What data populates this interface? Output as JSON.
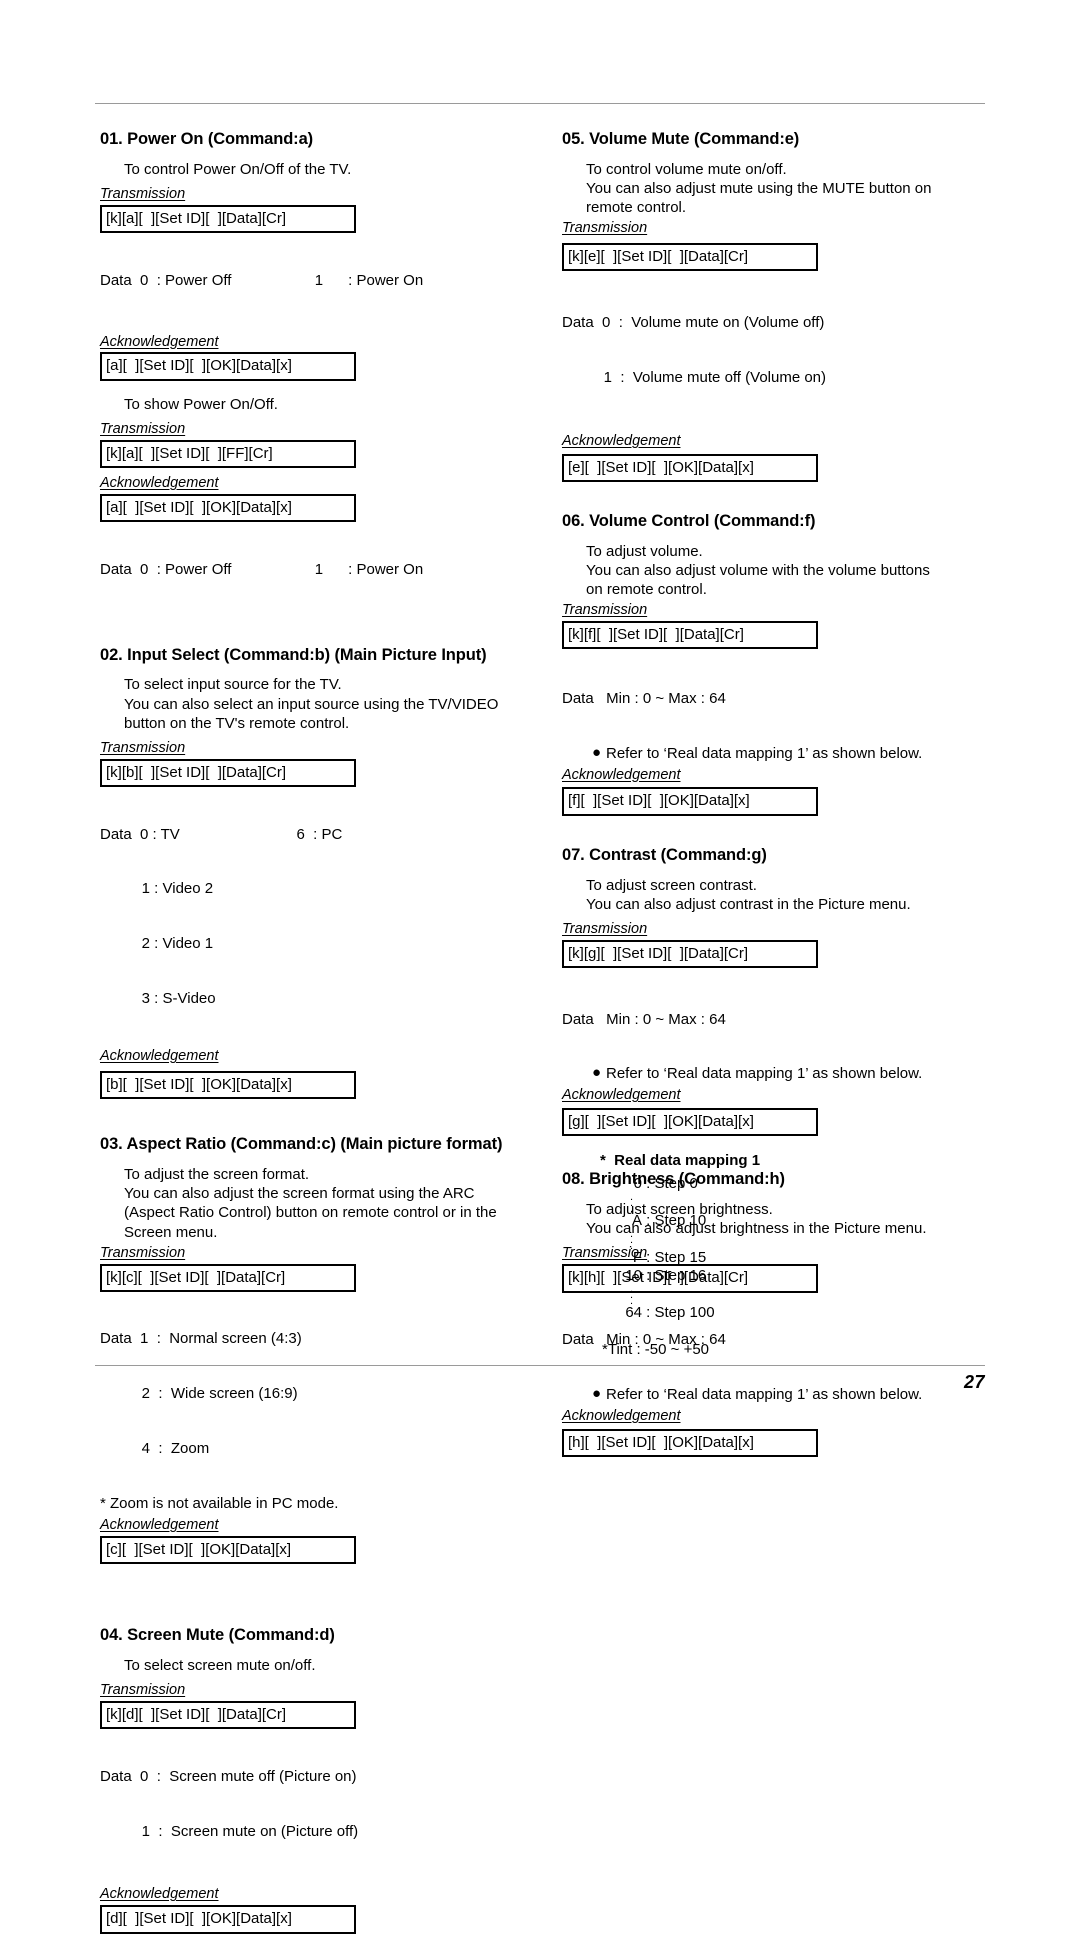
{
  "page": {
    "number": "27"
  },
  "sections": [
    {
      "id": "01",
      "title": "01. Power On (Command:a)",
      "desc": [
        "To control Power On/Off of the TV."
      ],
      "transmission_label": "Transmission",
      "transmission_box": "[k][a][  ][Set ID][  ][Data][Cr]",
      "data_lines": [
        "Data  0  : Power Off                    1      : Power On"
      ],
      "ack_label": "Acknowledgement",
      "ack_box": "[a][  ][Set ID][  ][OK][Data][x]",
      "desc2": [
        "To show Power On/Off."
      ],
      "transmission_label2": "Transmission",
      "transmission_box2": "[k][a][  ][Set ID][  ][FF][Cr]",
      "ack_label2": "Acknowledgement",
      "ack_box2": "[a][  ][Set ID][  ][OK][Data][x]",
      "data_lines2": [
        "Data  0  : Power Off                    1      : Power On"
      ]
    },
    {
      "id": "02",
      "title": "02. Input Select (Command:b) (Main Picture Input)",
      "desc": [
        "To select input source for the TV.",
        "You can also select an input source using the TV/VIDEO",
        "button on the TV's remote control."
      ],
      "transmission_label": "Transmission",
      "transmission_box": "[k][b][  ][Set ID][  ][Data][Cr]",
      "data_lines": [
        "Data  0 : TV                            6  : PC",
        "          1 : Video 2",
        "          2 : Video 1",
        "          3 : S-Video"
      ],
      "ack_label": "Acknowledgement",
      "ack_box": "[b][  ][Set ID][  ][OK][Data][x]"
    },
    {
      "id": "03",
      "title": "03. Aspect Ratio (Command:c) (Main picture format)",
      "desc": [
        "To adjust the screen format.",
        "You can also adjust the screen format using the ARC",
        "(Aspect Ratio Control) button on remote control or in the",
        "Screen menu."
      ],
      "transmission_label": "Transmission",
      "transmission_box": "[k][c][  ][Set ID][  ][Data][Cr]",
      "data_lines": [
        "Data  1  :  Normal screen (4:3)",
        "          2  :  Wide screen (16:9)",
        "          4  :  Zoom"
      ],
      "note": "* Zoom is not available in PC mode.",
      "ack_label": "Acknowledgement",
      "ack_box": "[c][  ][Set ID][  ][OK][Data][x]"
    },
    {
      "id": "04",
      "title": "04. Screen Mute (Command:d)",
      "desc": [
        "To select screen mute on/off."
      ],
      "transmission_label": "Transmission",
      "transmission_box": "[k][d][  ][Set ID][  ][Data][Cr]",
      "data_lines": [
        "Data  0  :  Screen mute off (Picture on)",
        "          1  :  Screen mute on (Picture off)"
      ],
      "ack_label": "Acknowledgement",
      "ack_box": "[d][  ][Set ID][  ][OK][Data][x]"
    },
    {
      "id": "05",
      "title": "05. Volume Mute (Command:e)",
      "desc": [
        "To control volume mute on/off.",
        "You can also adjust mute using the MUTE button on",
        "remote control."
      ],
      "transmission_label": "Transmission",
      "transmission_box": "[k][e][  ][Set ID][  ][Data][Cr]",
      "data_lines": [
        "Data  0  :  Volume mute on (Volume off)",
        "          1  :  Volume mute off (Volume on)"
      ],
      "ack_label": "Acknowledgement",
      "ack_box": "[e][  ][Set ID][  ][OK][Data][x]"
    },
    {
      "id": "06",
      "title": "06. Volume Control (Command:f)",
      "desc": [
        "To adjust volume.",
        "You can also adjust volume with the volume buttons",
        "on remote control."
      ],
      "transmission_label": "Transmission",
      "transmission_box": "[k][f][  ][Set ID][  ][Data][Cr]",
      "data_lines": [
        "Data   Min : 0 ~ Max : 64"
      ],
      "bullet": "Refer to ‘Real data mapping 1’ as shown below.",
      "ack_label": "Acknowledgement",
      "ack_box": "[f][  ][Set ID][  ][OK][Data][x]"
    },
    {
      "id": "07",
      "title": "07. Contrast (Command:g)",
      "desc": [
        "To adjust screen contrast.",
        "You can also adjust contrast in the Picture menu."
      ],
      "transmission_label": "Transmission",
      "transmission_box": "[k][g][  ][Set ID][  ][Data][Cr]",
      "data_lines": [
        "Data   Min : 0 ~ Max : 64"
      ],
      "bullet": "Refer to ‘Real data mapping 1’ as shown below.",
      "ack_label": "Acknowledgement",
      "ack_box": "[g][  ][Set ID][  ][OK][Data][x]"
    },
    {
      "id": "08",
      "title": "08. Brightness (Command:h)",
      "desc": [
        "To adjust screen brightness.",
        "You can also adjust brightness in the Picture menu."
      ],
      "transmission_label": "Transmission",
      "transmission_box": "[k][h][  ][Set ID][  ][Data][Cr]",
      "data_lines": [
        "Data   Min : 0 ~ Max : 64"
      ],
      "bullet": "Refer to ‘Real data mapping 1’ as shown below.",
      "ack_label": "Acknowledgement",
      "ack_box": "[h][  ][Set ID][  ][OK][Data][x]"
    }
  ],
  "mapping": {
    "title": "*  Real data mapping 1",
    "rows": [
      {
        "key": "0",
        "value": ": Step 0"
      },
      {
        "key": "A",
        "value": ": Step 10"
      },
      {
        "key": "F",
        "value": ": Step 15"
      },
      {
        "key": "10",
        "value": ": Step 16"
      },
      {
        "key": "64",
        "value": ": Step 100"
      }
    ],
    "tint": "*Tint : -50 ~ +50"
  }
}
